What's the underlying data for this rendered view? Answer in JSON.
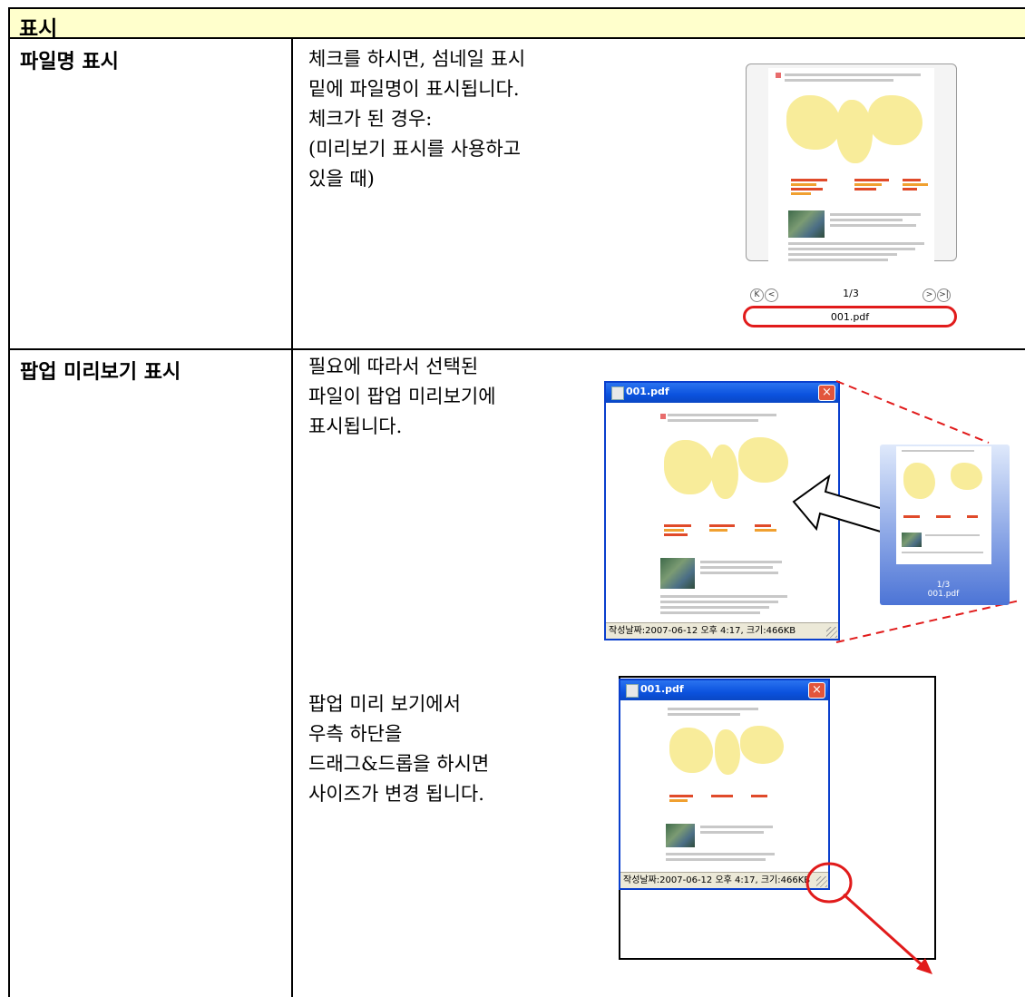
{
  "header": {
    "title": "표시"
  },
  "rows": [
    {
      "label": "파일명 표시",
      "desc": "체크를 하시면, 섬네일 표시\n밑에 파일명이 표시됩니다.\n체크가 된 경우:\n(미리보기 표시를 사용하고\n있을 때)"
    },
    {
      "label": "팝업 미리보기 표시",
      "desc": "필요에 따라서 선택된\n파일이 팝업 미리보기에\n표시됩니다.",
      "desc2": "팝업 미리 보기에서\n우측 하단을\n드래그&드롭을 하시면\n사이즈가 변경 됩니다."
    }
  ],
  "thumbnail": {
    "page_indicator": "1/3",
    "filename": "001.pdf",
    "nav_first": "K",
    "nav_prev": "<",
    "nav_next": ">",
    "nav_last": ">|"
  },
  "popup": {
    "title": "001.pdf",
    "close": "×",
    "status": "작성날짜:2007-06-12 오후 4:17, 크기:466KB"
  },
  "small_thumb": {
    "page_indicator": "1/3",
    "filename": "001.pdf"
  },
  "popup2": {
    "title": "001.pdf",
    "close": "×",
    "status": "작성날짜:2007-06-12 오후 4:17, 크기:466KB"
  },
  "colors": {
    "header_bg": "#ffffcc",
    "highlight": "#e11b1b",
    "xp_blue": "#0b52de"
  }
}
